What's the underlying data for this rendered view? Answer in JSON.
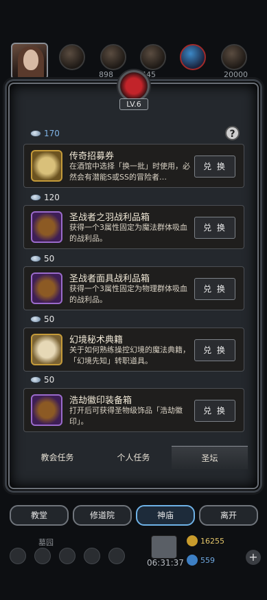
{
  "header": {
    "level": "LV.6",
    "resources": [
      "",
      "898",
      "445",
      "",
      "20000"
    ]
  },
  "currency": {
    "balance": "170"
  },
  "items": [
    {
      "name": "传奇招募券",
      "desc": "在酒馆中选择「换一批」时使用，必然会有潜能S或SS的冒险者…",
      "button": "兑 换",
      "icon": "scroll-icon",
      "cost": "120"
    },
    {
      "name": "圣战者之羽战利品箱",
      "desc": "获得一个3属性固定为魔法群体吸血的战利品。",
      "button": "兑 换",
      "icon": "chest-icon",
      "cost": "50"
    },
    {
      "name": "圣战者面具战利品箱",
      "desc": "获得一个3属性固定为物理群体吸血的战利品。",
      "button": "兑 换",
      "icon": "chest-icon",
      "cost": "50"
    },
    {
      "name": "幻境秘术典籍",
      "desc": "关于如何熟练操控幻境的魔法典籍，「幻境先知」转职道具。",
      "button": "兑 换",
      "icon": "book-icon",
      "cost": "50"
    },
    {
      "name": "浩劫徽印装备箱",
      "desc": "打开后可获得圣物级饰品「浩劫徽印」。",
      "button": "兑 换",
      "icon": "chest-icon"
    }
  ],
  "tabs": [
    "教会任务",
    "个人任务",
    "圣坛"
  ],
  "nav": [
    "教堂",
    "修道院",
    "神庙",
    "离开"
  ],
  "footer": {
    "location": "墓园",
    "timer": "06:31:37",
    "gold": "16255",
    "gems": "559"
  }
}
